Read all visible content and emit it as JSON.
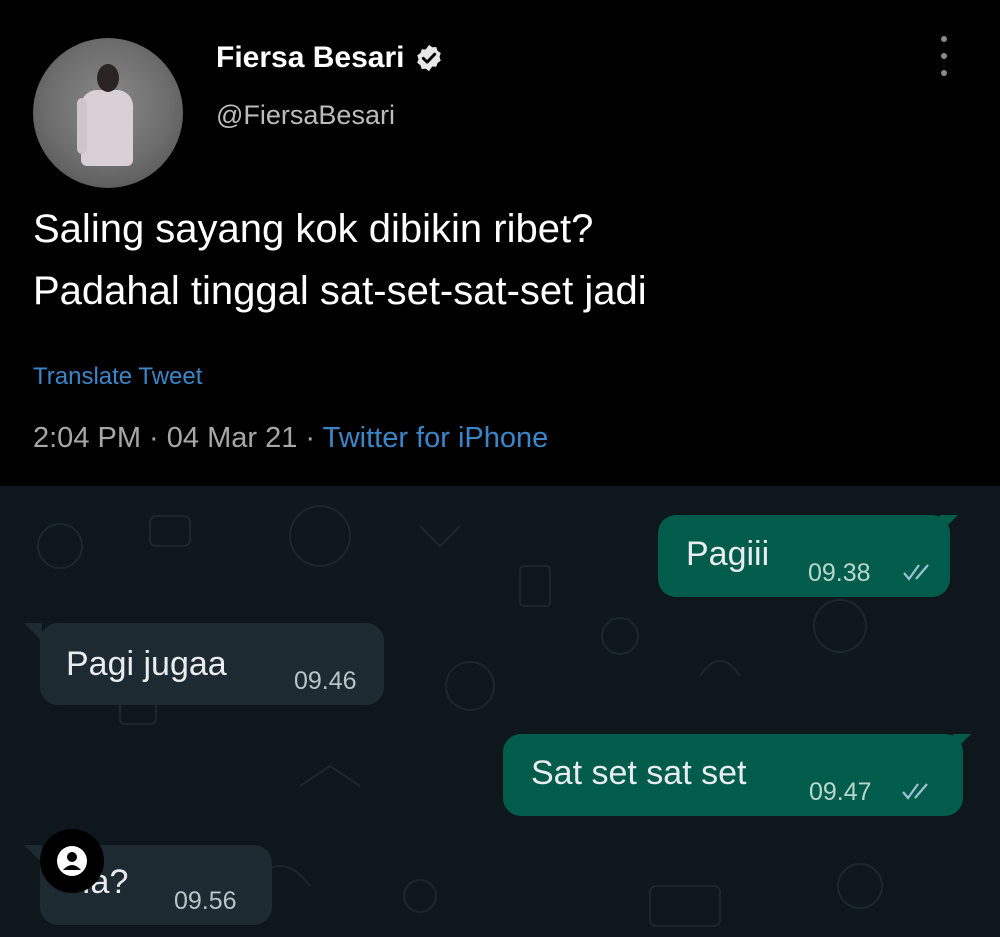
{
  "tweet": {
    "author_name": "Fiersa Besari",
    "author_handle": "@FiersaBesari",
    "text_line1": "Saling sayang kok dibikin ribet?",
    "text_line2": "Padahal tinggal sat-set-sat-set jadi",
    "translate_label": "Translate Tweet",
    "timestamp": "2:04 PM · 04 Mar 21 · ",
    "source": "Twitter for iPhone"
  },
  "chat": {
    "messages": [
      {
        "direction": "outgoing",
        "text": "Pagiii",
        "time": "09.38"
      },
      {
        "direction": "incoming",
        "text": "Pagi jugaa",
        "time": "09.46"
      },
      {
        "direction": "outgoing",
        "text": "Sat set sat set",
        "time": "09.47"
      },
      {
        "direction": "incoming",
        "text": "Ha?",
        "time": "09.56"
      }
    ]
  },
  "icons": {
    "verified": "verified-badge-icon",
    "more": "more-vertical-icon",
    "read_ticks": "double-check-icon",
    "profile": "profile-user-icon"
  },
  "colors": {
    "tweet_bg": "#000000",
    "link": "#3b86c8",
    "chat_bg": "#0d171c",
    "outgoing_bubble": "#015c4b",
    "incoming_bubble": "#1d2a31"
  }
}
